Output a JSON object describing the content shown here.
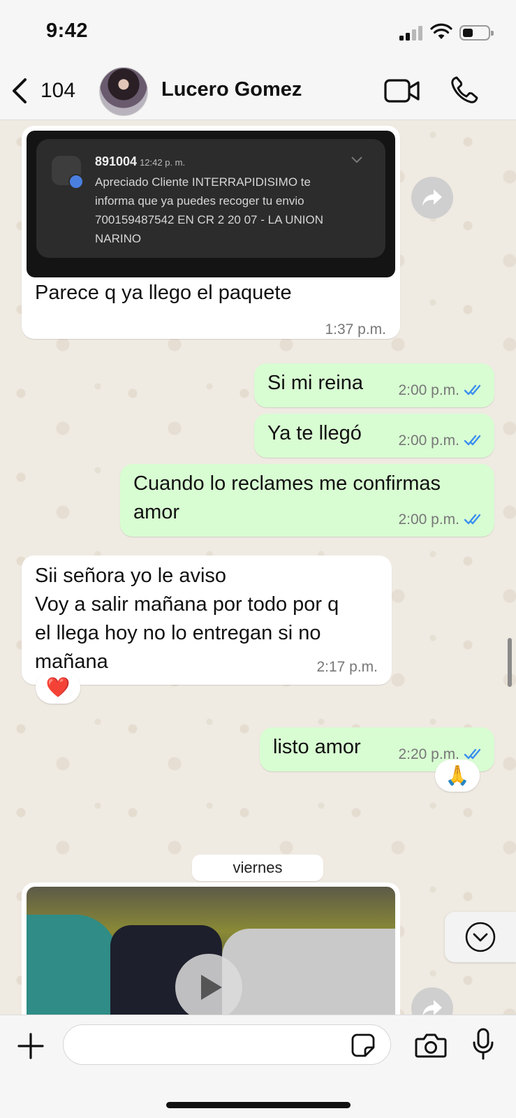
{
  "status_bar": {
    "time": "9:42"
  },
  "header": {
    "back_count": "104",
    "contact_name": "Lucero Gomez"
  },
  "messages": [
    {
      "direction": "in",
      "notification": {
        "sender": "891004",
        "time": "12:42 p. m.",
        "body": "Apreciado Cliente INTERRAPIDISIMO te informa que ya puedes recoger tu envio 700159487542 EN CR 2 20 07 - LA UNION NARINO"
      },
      "text": "Parece q ya llego el paquete",
      "time": "1:37 p.m."
    },
    {
      "direction": "out",
      "text": "Si mi reina",
      "time": "2:00 p.m.",
      "read": true
    },
    {
      "direction": "out",
      "text": "Ya te llegó",
      "time": "2:00 p.m.",
      "read": true
    },
    {
      "direction": "out",
      "text": "Cuando lo reclames me confirmas\namor",
      "time": "2:00 p.m.",
      "read": true
    },
    {
      "direction": "in",
      "text": "Sii señora yo le aviso\nVoy a salir mañana por todo por q\nel llega hoy no lo entregan si no\nmañana",
      "time": "2:17 p.m.",
      "reaction": "❤️"
    },
    {
      "direction": "out",
      "text": "listo amor",
      "time": "2:20 p.m.",
      "read": true,
      "reaction": "🙏"
    }
  ],
  "date_separator": "viernes",
  "input": {
    "placeholder": ""
  },
  "colors": {
    "incoming": "#ffffff",
    "outgoing": "#d8fdd2",
    "read_ticks": "#3a8ff0",
    "background": "#efeae2"
  },
  "icons": [
    "back-chevron",
    "video-call",
    "phone",
    "forward",
    "play",
    "chevron-down-circle",
    "plus",
    "sticker",
    "camera",
    "microphone"
  ]
}
